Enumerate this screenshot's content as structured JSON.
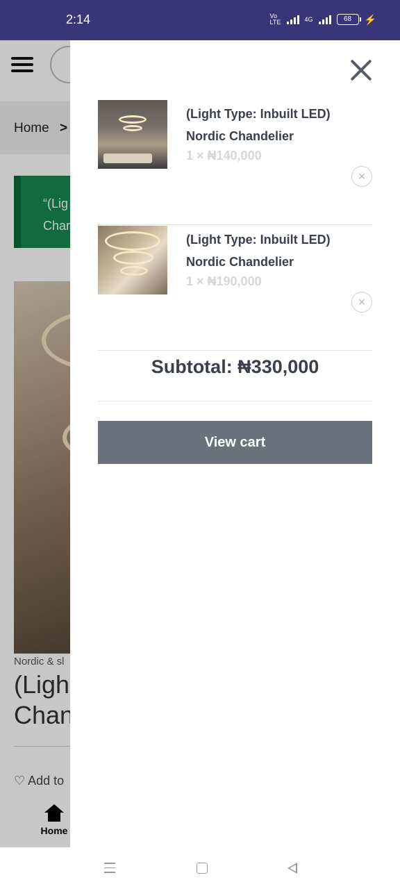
{
  "status_bar": {
    "time": "2:14",
    "network_label": "Vo LTE",
    "network_4g": "4G",
    "battery": "68"
  },
  "background_page": {
    "breadcrumb_home": "Home",
    "breadcrumb_separator": ">",
    "notice_text_line1": "“(Lig",
    "notice_text_line2": "Char",
    "category": "Nordic & sl",
    "product_title_line1": "(Ligh",
    "product_title_line2": "Chan",
    "wishlist_label": "Add to",
    "bottom_nav_home": "Home"
  },
  "cart": {
    "items": [
      {
        "title_line1": "(Light Type: Inbuilt LED)",
        "title_line2": "Nordic Chandelier",
        "quantity_price": "1 × ₦140,000",
        "remove_icon": "×"
      },
      {
        "title_line1": "(Light Type: Inbuilt LED)",
        "title_line2": "Nordic Chandelier",
        "quantity_price": "1 × ₦190,000",
        "remove_icon": "×"
      }
    ],
    "subtotal": "Subtotal: ₦330,000",
    "view_cart_label": "View cart"
  },
  "colors": {
    "status_bar": "#3a3576",
    "button": "#6b727e",
    "notice": "#178a4d"
  }
}
